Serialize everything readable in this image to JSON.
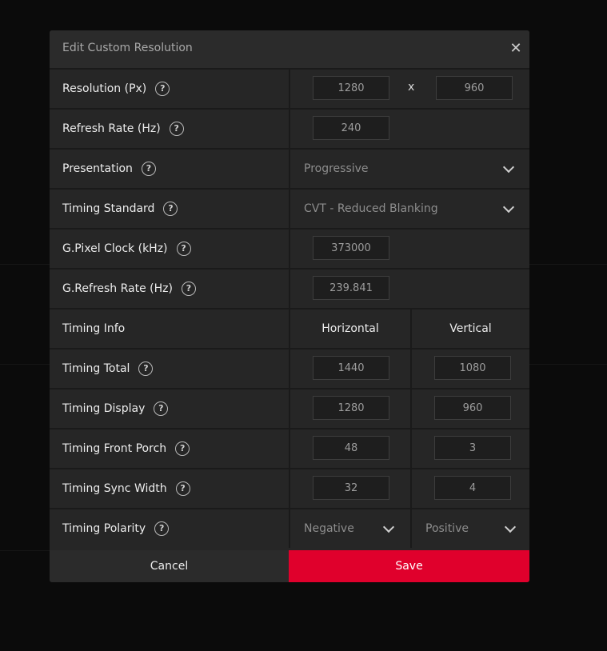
{
  "dialog": {
    "title": "Edit Custom Resolution",
    "close_icon": "close-icon"
  },
  "rows": {
    "resolution": {
      "label": "Resolution (Px)",
      "width": "1280",
      "x": "x",
      "height": "960"
    },
    "refresh_rate": {
      "label": "Refresh Rate (Hz)",
      "value": "240"
    },
    "presentation": {
      "label": "Presentation",
      "selected": "Progressive"
    },
    "timing_standard": {
      "label": "Timing Standard",
      "selected": "CVT - Reduced Blanking"
    },
    "pixel_clock": {
      "label": "G.Pixel Clock (kHz)",
      "value": "373000"
    },
    "g_refresh_rate": {
      "label": "G.Refresh Rate (Hz)",
      "value": "239.841"
    },
    "timing_info": {
      "label": "Timing Info",
      "horizontal": "Horizontal",
      "vertical": "Vertical"
    },
    "timing_total": {
      "label": "Timing Total",
      "h": "1440",
      "v": "1080"
    },
    "timing_display": {
      "label": "Timing Display",
      "h": "1280",
      "v": "960"
    },
    "timing_front_porch": {
      "label": "Timing Front Porch",
      "h": "48",
      "v": "3"
    },
    "timing_sync_width": {
      "label": "Timing Sync Width",
      "h": "32",
      "v": "4"
    },
    "timing_polarity": {
      "label": "Timing Polarity",
      "h": "Negative",
      "v": "Positive"
    }
  },
  "help_glyph": "?",
  "footer": {
    "cancel_label": "Cancel",
    "save_label": "Save"
  },
  "colors": {
    "accent": "#e0002c",
    "panel": "#262626",
    "divider": "#1a1a1a"
  }
}
